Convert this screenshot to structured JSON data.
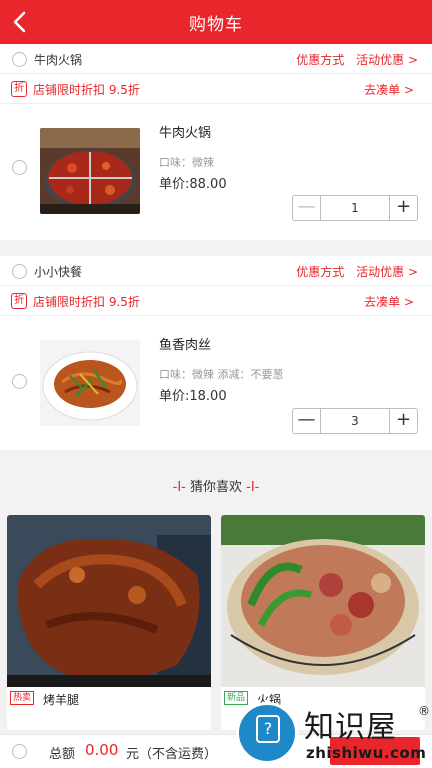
{
  "header": {
    "title": "购物车"
  },
  "shops": [
    {
      "name": "牛肉火锅",
      "links": [
        "优惠方式",
        "活动优惠 >"
      ],
      "promo": "店铺限时折扣 9.5折",
      "promo_link": "去凑单 >",
      "promo_icon": "折",
      "item": {
        "name": "牛肉火锅",
        "flavor": "口味：微辣",
        "price": "单价:88.00",
        "qty": "1"
      }
    },
    {
      "name": "小小快餐",
      "links": [
        "优惠方式",
        "活动优惠 >"
      ],
      "promo": "店铺限时折扣 9.5折",
      "promo_link": "去凑单 >",
      "promo_icon": "折",
      "item": {
        "name": "鱼香肉丝",
        "flavor": "口味：微辣  添减：不要葱",
        "price": "单价:18.00",
        "qty": "3"
      }
    }
  ],
  "guess": {
    "title": "猜你喜欢",
    "items": [
      {
        "tag": "热卖",
        "name": "烤羊腿",
        "tag_color": "#e8262b"
      },
      {
        "tag": "新品",
        "name": "火锅",
        "tag_color": "#3aa856"
      }
    ]
  },
  "footer": {
    "total_label": "总额",
    "total_value": "0.00",
    "total_unit": "元（不含运费）"
  },
  "stepper": {
    "minus": "—",
    "plus": "+"
  },
  "watermark": {
    "brand": "知识屋",
    "domain": "zhishiwu.com",
    "reg": "®"
  },
  "colors": {
    "accent": "#e8262b",
    "page_bg": "#f2f2f2"
  }
}
